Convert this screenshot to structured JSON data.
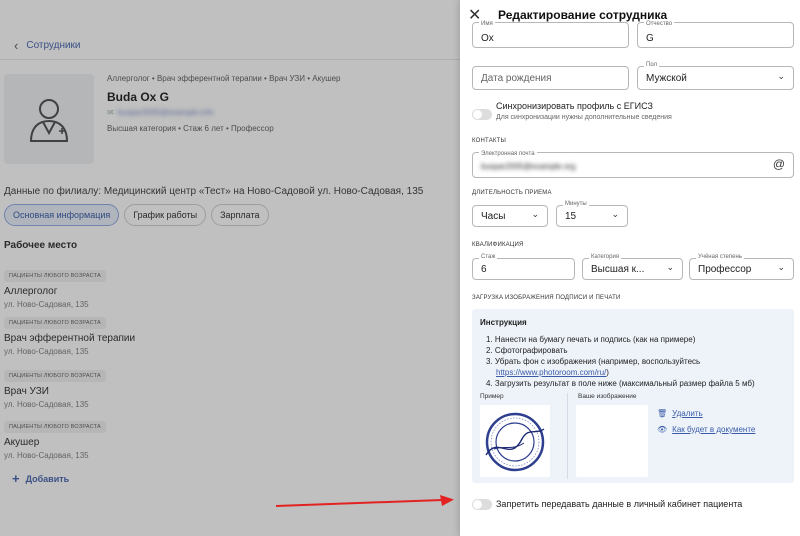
{
  "background": {
    "back_label": "Сотрудники",
    "specialties_line": "Аллерголог • Врач эфферентной терапии • Врач УЗИ • Акушер",
    "employee_name": "Buda Ox G",
    "employee_email": "buspar2005@example.info",
    "employee_meta": "Высшая категория • Стаж 6 лет • Профессор",
    "branch_line": "Данные по филиалу: Медицинский центр «Тест» на Ново-Садовой ул. Ново-Садовая, 135",
    "tabs": [
      {
        "label": "Основная информация"
      },
      {
        "label": "График работы"
      },
      {
        "label": "Зарплата"
      }
    ],
    "workplace_title": "Рабочее место",
    "workplaces": [
      {
        "badge": "Пациенты любого возраста",
        "name": "Аллерголог",
        "address": "ул. Ново-Садовая, 135"
      },
      {
        "badge": "Пациенты любого возраста",
        "name": "Врач эфферентной терапии",
        "address": "ул. Ново-Садовая, 135"
      },
      {
        "badge": "Пациенты любого возраста",
        "name": "Врач УЗИ",
        "address": "ул. Ново-Садовая, 135"
      },
      {
        "badge": "Пациенты любого возраста",
        "name": "Акушер",
        "address": "ул. Ново-Садовая, 135"
      }
    ],
    "add_label": "Добавить"
  },
  "drawer": {
    "title": "Редактирование сотрудника",
    "name_label": "Имя",
    "name_value": "Ox",
    "patronymic_label": "Отчество",
    "patronymic_value": "G",
    "birthdate_placeholder": "Дата рождения",
    "gender_label": "Пол",
    "gender_value": "Мужской",
    "sync_label": "Синхронизировать профиль с ЕГИСЗ",
    "sync_sub": "Для синхронизации нужны дополнительные сведения",
    "contacts_section": "Контакты",
    "email_label": "Электронная почта",
    "email_value": "buspar2005@example.org",
    "duration_section": "Длительность приема",
    "hours_value": "Часы",
    "minutes_label": "Минуты",
    "minutes_value": "15",
    "qualification_section": "Квалификация",
    "experience_label": "Стаж",
    "experience_value": "6",
    "category_label": "Категория",
    "category_value": "Высшая к...",
    "degree_label": "Учёная степень",
    "degree_value": "Профессор",
    "upload_section": "Загрузка изображения подписи и печати",
    "instruction_title": "Инструкция",
    "instruction_1": "1. Нанести на бумагу печать и подпись (как на примере)",
    "instruction_2": "2. Сфотографировать",
    "instruction_3": "3. Убрать фон с изображения (например, воспользуйтесь",
    "instruction_link": "https://www.photoroom.com/ru/",
    "instruction_link_tail": ")",
    "instruction_4": "4. Загрузить результат в поле ниже (максимальный размер файла 5 мб)",
    "example_label": "Пример",
    "your_image_label": "Ваше изображение",
    "delete_label": "Удалить",
    "preview_label": "Как будет в документе",
    "forbid_label": "Запретить передавать данные в личный кабинет пациента"
  },
  "colors": {
    "accent": "#3a5ba8",
    "annotation_arrow": "#e32222"
  }
}
